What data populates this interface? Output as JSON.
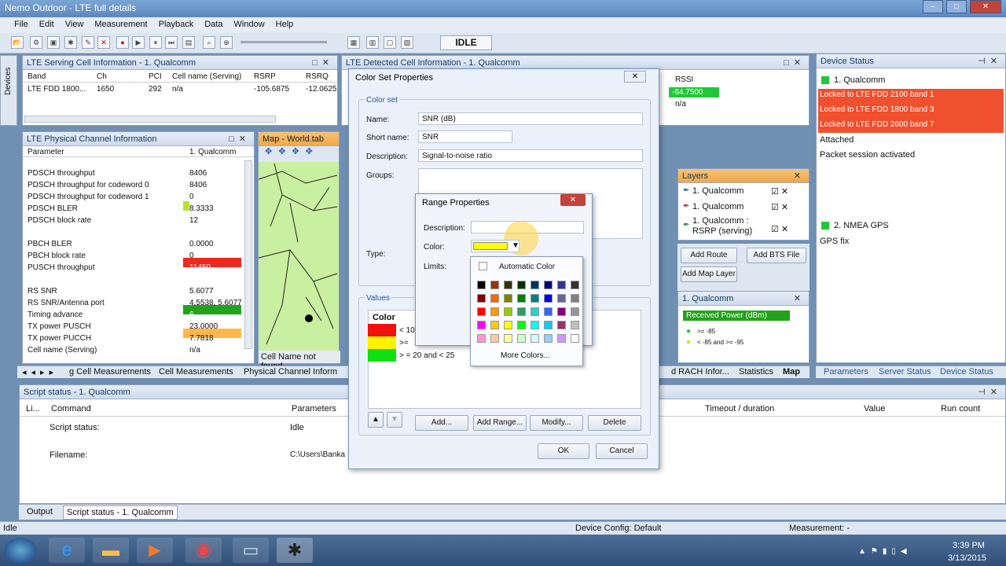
{
  "window": {
    "title": "Nemo Outdoor - LTE full details"
  },
  "menu": [
    "File",
    "Edit",
    "View",
    "Measurement",
    "Playback",
    "Data",
    "Window",
    "Help"
  ],
  "toolbar": {
    "state": "IDLE"
  },
  "side_tab": "Devices",
  "serving": {
    "title": "LTE Serving Cell Information - 1. Qualcomm",
    "headers": [
      "Band",
      "Ch",
      "PCI",
      "Cell name (Serving)",
      "RSRP",
      "RSRQ"
    ],
    "row": [
      "LTE FDD 1800...",
      "1650",
      "292",
      "n/a",
      "-105.6875",
      "-12.0625"
    ]
  },
  "detected": {
    "title": "LTE Detected Cell Information - 1. Qualcomm",
    "rssi_header": "RSSI",
    "rssi": "-84.7500",
    "rssi2": "n/a",
    "colors": {
      "green": "#22c63a"
    }
  },
  "phy": {
    "title": "LTE Physical Channel Information",
    "headers": [
      "Parameter",
      "1. Qualcomm"
    ],
    "rows": [
      [
        "PDSCH throughput",
        "8406"
      ],
      [
        "PDSCH throughput for codeword 0",
        "8406"
      ],
      [
        "PDSCH throughput for codeword 1",
        "0"
      ],
      [
        "PDSCH BLER",
        "8.3333"
      ],
      [
        "PDSCH block rate",
        "12"
      ],
      [
        "PBCH BLER",
        "0.0000"
      ],
      [
        "PBCH block rate",
        "0"
      ],
      [
        "PUSCH throughput",
        "11450"
      ],
      [
        "RS SNR",
        "5.6077"
      ],
      [
        "RS SNR/Antenna port",
        "4.5538, 5.6077"
      ],
      [
        "Timing advance",
        "6"
      ],
      [
        "TX power PUSCH",
        "23.0000"
      ],
      [
        "TX power PUCCH",
        "7.7818"
      ],
      [
        "Cell name (Serving)",
        "n/a"
      ]
    ]
  },
  "map": {
    "title": "Map - World.tab",
    "not_found": "Cell Name not found"
  },
  "device_status": {
    "title": "Device Status",
    "device1": "1. Qualcomm",
    "items": [
      "Locked to LTE FDD 2100 band 1",
      "Locked to LTE FDD 1800 band 3",
      "Locked to LTE FDD 2600 band 7",
      "Attached",
      "Packet session activated"
    ],
    "device2": "2. NMEA GPS",
    "gps": "GPS fix",
    "colors": {
      "red": "#f0502d"
    }
  },
  "layers": {
    "title": "Layers",
    "items": [
      "1. Qualcomm",
      "1. Qualcomm",
      "1. Qualcomm : RSRP (serving)"
    ],
    "buttons": [
      "Add Route",
      "Add BTS File",
      "Add Map Layer"
    ],
    "legend_title": "1. Qualcomm",
    "legend_header": "Received Power (dBm)",
    "legend": [
      ">= -85",
      "< -85 and >= -95"
    ]
  },
  "tabs": [
    "g Cell Measurements",
    "Cell Measurements",
    "Physical Channel Inform",
    "d RACH Infor...",
    "Statistics",
    "Map"
  ],
  "right_tabs": [
    "Parameters",
    "Server Status",
    "Device Status"
  ],
  "script": {
    "title": "Script status - 1. Qualcomm",
    "headers": [
      "Li...",
      "Command",
      "Parameters",
      "Timeout / duration",
      "Value",
      "Run count"
    ],
    "rows": [
      [
        "Script status:",
        "Idle"
      ],
      [
        "Filename:",
        "C:\\Users\\Banka"
      ]
    ]
  },
  "bottom_tabs": [
    "Output",
    "Script status - 1. Qualcomm"
  ],
  "statusbar": {
    "left": "Idle",
    "config": "Device Config: Default",
    "measurement": "Measurement: -"
  },
  "colorset": {
    "title": "Color Set Properties",
    "group": "Color set",
    "name_label": "Name:",
    "name": "SNR (dB)",
    "short_label": "Short name:",
    "short": "SNR",
    "desc_label": "Description:",
    "desc": "Signal-to-noise ratio",
    "groups_label": "Groups:",
    "type_label": "Type:",
    "values_group": "Values",
    "color_header": "Color",
    "value_rows": [
      "< 10",
      ">= ",
      "> = 20 and < 25"
    ],
    "buttons": [
      "Add...",
      "Add Range...",
      "Modify...",
      "Delete"
    ],
    "ok": "OK",
    "cancel": "Cancel"
  },
  "range": {
    "title": "Range Properties",
    "desc_label": "Description:",
    "color_label": "Color:",
    "limits_label": "Limits:",
    "auto": "Automatic Color",
    "more": "More Colors...",
    "colors": {
      "selected": "#ffff00",
      "highlight": "#ffe066"
    }
  },
  "clock": {
    "time": "3:39 PM",
    "date": "3/13/2015"
  }
}
